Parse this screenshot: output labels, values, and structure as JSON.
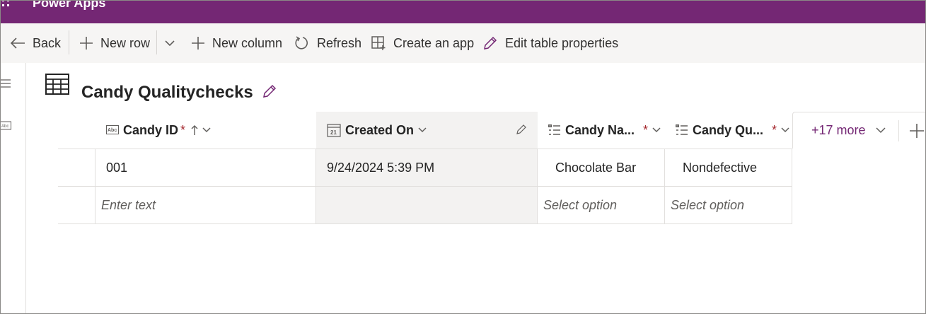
{
  "app": {
    "title": "Power Apps"
  },
  "toolbar": {
    "back": "Back",
    "new_row": "New row",
    "new_column": "New column",
    "refresh": "Refresh",
    "create_app": "Create an app",
    "edit_table_properties": "Edit table properties"
  },
  "table": {
    "title": "Candy Qualitychecks",
    "columns": [
      {
        "label": "Candy ID",
        "required": "*",
        "type_icon": "text-type-icon",
        "sorted": "ascending"
      },
      {
        "label": "Created On",
        "type_icon": "calendar-icon",
        "type_icon_text": "21"
      },
      {
        "label": "Candy Na...",
        "required": "*",
        "type_icon": "choice-list-icon"
      },
      {
        "label": "Candy Qu...",
        "required": "*",
        "type_icon": "choice-list-icon"
      }
    ],
    "more_columns": "+17 more",
    "rows": [
      {
        "candy_id": "001",
        "created_on": "9/24/2024 5:39 PM",
        "candy_name": "Chocolate Bar",
        "candy_quality": "Nondefective"
      }
    ],
    "new_row": {
      "candy_id_placeholder": "Enter text",
      "candy_name_placeholder": "Select option",
      "candy_quality_placeholder": "Select option"
    }
  },
  "colors": {
    "brand": "#742774",
    "required": "#a4262c"
  }
}
